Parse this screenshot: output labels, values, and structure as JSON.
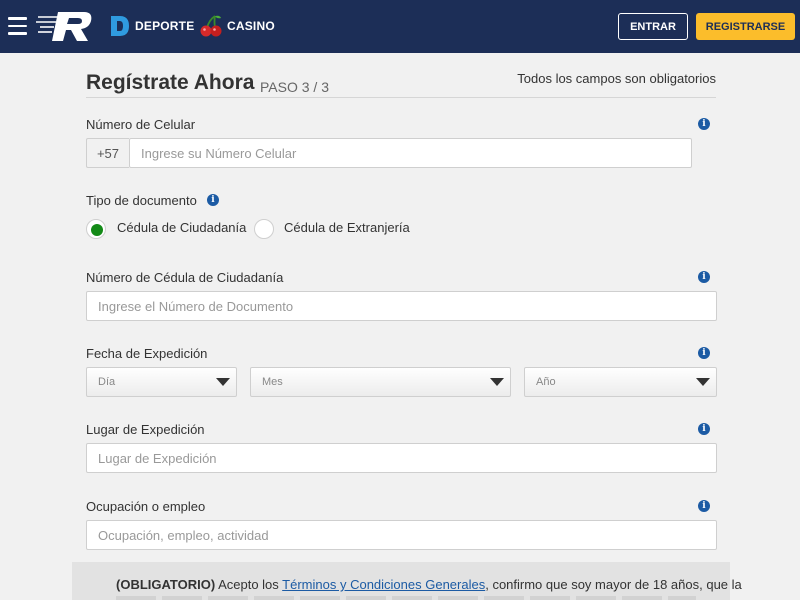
{
  "header": {
    "nav": [
      {
        "label": "DEPORTE",
        "icon": "deporte-d-icon"
      },
      {
        "label": "CASINO",
        "icon": "cherry-icon"
      }
    ],
    "login_label": "ENTRAR",
    "register_label": "REGISTRARSE",
    "colors": {
      "bar": "#1c2e57",
      "register_button": "#fbbd2b",
      "accent_blue": "#1c5ba4"
    }
  },
  "form": {
    "title": "Regístrate Ahora",
    "step": "PASO 3 / 3",
    "required_note": "Todos los campos son obligatorios",
    "phone": {
      "label": "Número de Celular",
      "prefix": "+57",
      "placeholder": "Ingrese su Número Celular"
    },
    "document_type": {
      "label": "Tipo de documento",
      "options": [
        {
          "label": "Cédula de Ciudadanía",
          "selected": true
        },
        {
          "label": "Cédula de Extranjería",
          "selected": false
        }
      ],
      "selected_color": "#138a17"
    },
    "document_number": {
      "label": "Número de Cédula de Ciudadanía",
      "placeholder": "Ingrese el Número de Documento"
    },
    "expedition_date": {
      "label": "Fecha de Expedición",
      "day": "Día",
      "month": "Mes",
      "year": "Año"
    },
    "expedition_place": {
      "label": "Lugar de Expedición",
      "placeholder": "Lugar de Expedición"
    },
    "occupation": {
      "label": "Ocupación o empleo",
      "placeholder": "Ocupación, empleo, actividad"
    },
    "terms": {
      "prefix": "(OBLIGATORIO)",
      "text_before": " Acepto los ",
      "link": "Términos y Condiciones Generales",
      "text_after": ", confirmo que soy mayor de 18 años, que la"
    }
  }
}
